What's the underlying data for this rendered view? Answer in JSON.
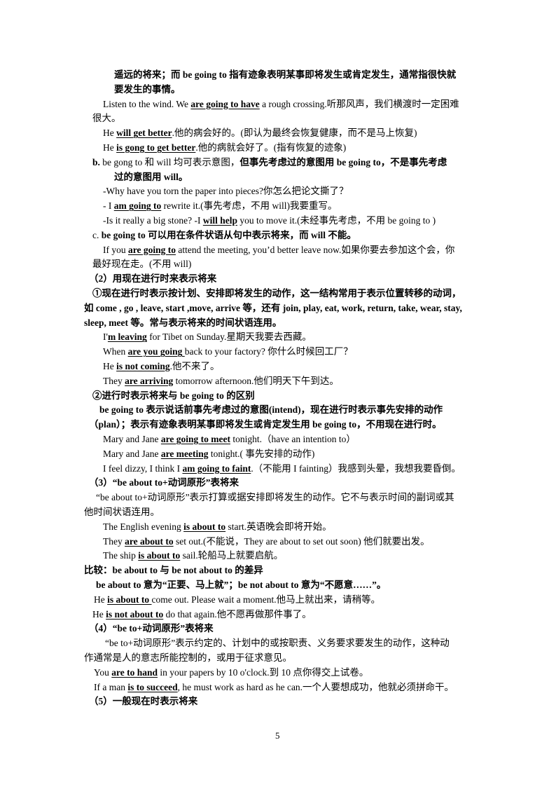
{
  "page_number": "5",
  "lines": [
    [
      {
        "t": "遥远的将来；而 be going to  指有迹象表明某事即将发生或肯定发生，通常指很快就",
        "s": "b"
      }
    ],
    [
      {
        "t": "要发生的事情。",
        "s": "b"
      }
    ],
    [
      {
        "t": "Listen to the wind. We ",
        "s": ""
      },
      {
        "t": "are going to have",
        "s": "bu"
      },
      {
        "t": " a rough crossing.听那风声，我们横渡时一定困难",
        "s": ""
      }
    ],
    [
      {
        "t": "很大。",
        "s": ""
      }
    ],
    [
      {
        "t": "He ",
        "s": ""
      },
      {
        "t": "will get better",
        "s": "bu"
      },
      {
        "t": ".他的病会好的。(即认为最终会恢复健康，而不是马上恢复)",
        "s": ""
      }
    ],
    [
      {
        "t": "He ",
        "s": ""
      },
      {
        "t": "is gong to get better",
        "s": "bu"
      },
      {
        "t": ".他的病就会好了。(指有恢复的迹象)",
        "s": ""
      }
    ],
    [
      {
        "t": "b.    ",
        "s": "b"
      },
      {
        "t": "be gong to  和 will 均可表示意图，",
        "s": ""
      },
      {
        "t": "但事先考虑过的意图用 be going to，不是事先考虑",
        "s": "b"
      }
    ],
    [
      {
        "t": "过的意图用 will。",
        "s": "b"
      }
    ],
    [
      {
        "t": "-Why have you torn the paper into pieces?你怎么把论文撕了？",
        "s": ""
      }
    ],
    [
      {
        "t": "- I ",
        "s": ""
      },
      {
        "t": "am going to",
        "s": "bu"
      },
      {
        "t": " rewrite it.(事先考虑，不用 will)我要重写。",
        "s": ""
      }
    ],
    [
      {
        "t": "-Is it really a big stone?    -I ",
        "s": ""
      },
      {
        "t": "will help",
        "s": "bu"
      },
      {
        "t": " you to move it.(未经事先考虑，不用 be going to )",
        "s": ""
      }
    ],
    [
      {
        "t": "c.    ",
        "s": ""
      },
      {
        "t": "be going to 可以用在条件状语从句中表示将来，而 will 不能。",
        "s": "b"
      }
    ],
    [
      {
        "t": "If you ",
        "s": ""
      },
      {
        "t": "are going to",
        "s": "bu"
      },
      {
        "t": " attend the meeting, you’d better leave now.如果你要去参加这个会，你",
        "s": ""
      }
    ],
    [
      {
        "t": "最好现在走。(不用 will)",
        "s": ""
      }
    ],
    [
      {
        "t": "（2）用现在进行时来表示将来",
        "s": "b"
      }
    ],
    [
      {
        "t": "①现在进行时表示按计划、安排即将发生的动作，这一结构常用于表示位置转移的动词，",
        "s": "b"
      }
    ],
    [
      {
        "t": "如 come , go , leave, start ,move, arrive 等，还有 join, play, eat, work, return, take, wear, stay,",
        "s": "b"
      }
    ],
    [
      {
        "t": "sleep, meet 等。常与表示将来的时间状语连用。",
        "s": "b"
      }
    ],
    [
      {
        "t": "I'",
        "s": ""
      },
      {
        "t": "m leaving",
        "s": "bu"
      },
      {
        "t": " for Tibet on Sunday.星期天我要去西藏。",
        "s": ""
      }
    ],
    [
      {
        "t": "When ",
        "s": ""
      },
      {
        "t": "are you going ",
        "s": "bu"
      },
      {
        "t": "back to your factory?  你什么时候回工厂？",
        "s": ""
      }
    ],
    [
      {
        "t": "He ",
        "s": ""
      },
      {
        "t": "is not coming",
        "s": "bu"
      },
      {
        "t": ".他不来了。",
        "s": ""
      }
    ],
    [
      {
        "t": "They ",
        "s": ""
      },
      {
        "t": "are arriving",
        "s": "bu"
      },
      {
        "t": " tomorrow afternoon.他们明天下午到达。",
        "s": ""
      }
    ],
    [
      {
        "t": "②进行时表示将来与 be going to  的区别",
        "s": "b"
      }
    ],
    [
      {
        "t": "be going to  表示说话前事先考虑过的意图(intend)，现在进行时表示事先安排的动作",
        "s": "b"
      }
    ],
    [
      {
        "t": "（plan）；表示有迹象表明某事即将发生或肯定发生用 be going to，不用现在进行时。",
        "s": "b"
      }
    ],
    [
      {
        "t": "Mary and Jane ",
        "s": ""
      },
      {
        "t": "are going to meet",
        "s": "bu"
      },
      {
        "t": " tonight.（have an intention to）",
        "s": ""
      }
    ],
    [
      {
        "t": "Mary and Jane ",
        "s": ""
      },
      {
        "t": "are meeting",
        "s": "bu"
      },
      {
        "t": " tonight.(  事先安排的动作)",
        "s": ""
      }
    ],
    [
      {
        "t": "I feel dizzy, I think I ",
        "s": ""
      },
      {
        "t": "am going to faint",
        "s": "bu"
      },
      {
        "t": ".（不能用 I fainting）我感到头晕，我想我要昏倒。",
        "s": ""
      }
    ],
    [
      {
        "t": "（3）“be about to+动词原形”表将来",
        "s": "b"
      }
    ],
    [
      {
        "t": "“be about to+动词原形”表示打算或据安排即将发生的动作。它不与表示时间的副词或其",
        "s": ""
      }
    ],
    [
      {
        "t": "他时间状语连用。",
        "s": ""
      }
    ],
    [
      {
        "t": "The English evening ",
        "s": ""
      },
      {
        "t": "is about to",
        "s": "bu"
      },
      {
        "t": " start.英语晚会即将开始。",
        "s": ""
      }
    ],
    [
      {
        "t": "They ",
        "s": ""
      },
      {
        "t": "are about to",
        "s": "bu"
      },
      {
        "t": " set out.(不能说，They are about to set out soon)  他们就要出发。",
        "s": ""
      }
    ],
    [
      {
        "t": "The ship ",
        "s": ""
      },
      {
        "t": "is about to",
        "s": "bu"
      },
      {
        "t": " sail.轮船马上就要启航。",
        "s": ""
      }
    ],
    [
      {
        "t": "比较：be about to  与 be not about to  的差异",
        "s": "b"
      }
    ],
    [
      {
        "t": "be about to  意为“正要、马上就”；be not about to  意为“不愿意……”。",
        "s": "b"
      }
    ],
    [
      {
        "t": "He ",
        "s": ""
      },
      {
        "t": "is about to ",
        "s": "bu"
      },
      {
        "t": "come out. Please wait a moment.他马上就出来，请稍等。",
        "s": ""
      }
    ],
    [
      {
        "t": "He ",
        "s": ""
      },
      {
        "t": "is not about to",
        "s": "bu"
      },
      {
        "t": " do that again.他不愿再做那件事了。",
        "s": ""
      }
    ],
    [
      {
        "t": "（4）“be to+动词原形”表将来",
        "s": "b"
      }
    ],
    [
      {
        "t": "“be to+动词原形”表示约定的、计划中的或按职责、义务要求要发生的动作，这种动",
        "s": ""
      }
    ],
    [
      {
        "t": "作通常是人的意志所能控制的，或用于征求意见。",
        "s": ""
      }
    ],
    [
      {
        "t": "You ",
        "s": ""
      },
      {
        "t": "are to hand",
        "s": "bu"
      },
      {
        "t": " in your papers by 10 o'clock.到 10 点你得交上试卷。",
        "s": ""
      }
    ],
    [
      {
        "t": "If a man ",
        "s": ""
      },
      {
        "t": "is to succeed",
        "s": "bu"
      },
      {
        "t": ", he must work as hard as he can.一个人要想成功，他就必须拼命干。",
        "s": ""
      }
    ],
    [
      {
        "t": "（5）一般现在时表示将来",
        "s": "b"
      }
    ]
  ]
}
